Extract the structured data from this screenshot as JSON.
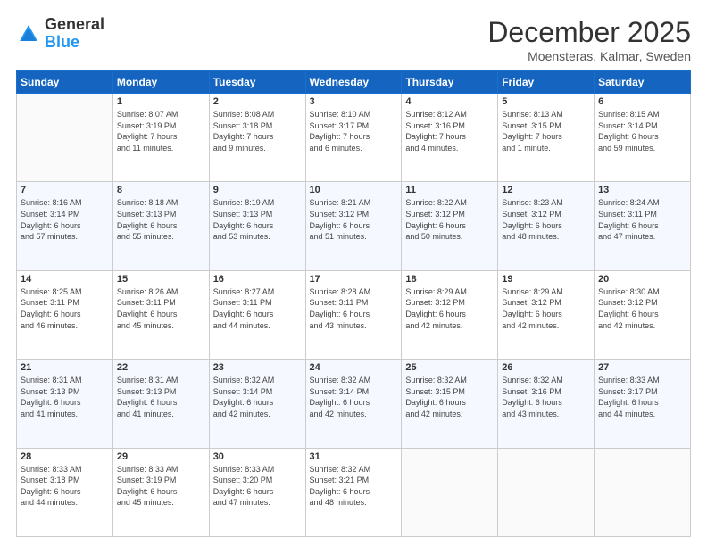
{
  "header": {
    "logo": {
      "line1": "General",
      "line2": "Blue"
    },
    "title": "December 2025",
    "subtitle": "Moensteras, Kalmar, Sweden"
  },
  "days_of_week": [
    "Sunday",
    "Monday",
    "Tuesday",
    "Wednesday",
    "Thursday",
    "Friday",
    "Saturday"
  ],
  "weeks": [
    [
      {
        "day": "",
        "info": ""
      },
      {
        "day": "1",
        "info": "Sunrise: 8:07 AM\nSunset: 3:19 PM\nDaylight: 7 hours\nand 11 minutes."
      },
      {
        "day": "2",
        "info": "Sunrise: 8:08 AM\nSunset: 3:18 PM\nDaylight: 7 hours\nand 9 minutes."
      },
      {
        "day": "3",
        "info": "Sunrise: 8:10 AM\nSunset: 3:17 PM\nDaylight: 7 hours\nand 6 minutes."
      },
      {
        "day": "4",
        "info": "Sunrise: 8:12 AM\nSunset: 3:16 PM\nDaylight: 7 hours\nand 4 minutes."
      },
      {
        "day": "5",
        "info": "Sunrise: 8:13 AM\nSunset: 3:15 PM\nDaylight: 7 hours\nand 1 minute."
      },
      {
        "day": "6",
        "info": "Sunrise: 8:15 AM\nSunset: 3:14 PM\nDaylight: 6 hours\nand 59 minutes."
      }
    ],
    [
      {
        "day": "7",
        "info": "Sunrise: 8:16 AM\nSunset: 3:14 PM\nDaylight: 6 hours\nand 57 minutes."
      },
      {
        "day": "8",
        "info": "Sunrise: 8:18 AM\nSunset: 3:13 PM\nDaylight: 6 hours\nand 55 minutes."
      },
      {
        "day": "9",
        "info": "Sunrise: 8:19 AM\nSunset: 3:13 PM\nDaylight: 6 hours\nand 53 minutes."
      },
      {
        "day": "10",
        "info": "Sunrise: 8:21 AM\nSunset: 3:12 PM\nDaylight: 6 hours\nand 51 minutes."
      },
      {
        "day": "11",
        "info": "Sunrise: 8:22 AM\nSunset: 3:12 PM\nDaylight: 6 hours\nand 50 minutes."
      },
      {
        "day": "12",
        "info": "Sunrise: 8:23 AM\nSunset: 3:12 PM\nDaylight: 6 hours\nand 48 minutes."
      },
      {
        "day": "13",
        "info": "Sunrise: 8:24 AM\nSunset: 3:11 PM\nDaylight: 6 hours\nand 47 minutes."
      }
    ],
    [
      {
        "day": "14",
        "info": "Sunrise: 8:25 AM\nSunset: 3:11 PM\nDaylight: 6 hours\nand 46 minutes."
      },
      {
        "day": "15",
        "info": "Sunrise: 8:26 AM\nSunset: 3:11 PM\nDaylight: 6 hours\nand 45 minutes."
      },
      {
        "day": "16",
        "info": "Sunrise: 8:27 AM\nSunset: 3:11 PM\nDaylight: 6 hours\nand 44 minutes."
      },
      {
        "day": "17",
        "info": "Sunrise: 8:28 AM\nSunset: 3:11 PM\nDaylight: 6 hours\nand 43 minutes."
      },
      {
        "day": "18",
        "info": "Sunrise: 8:29 AM\nSunset: 3:12 PM\nDaylight: 6 hours\nand 42 minutes."
      },
      {
        "day": "19",
        "info": "Sunrise: 8:29 AM\nSunset: 3:12 PM\nDaylight: 6 hours\nand 42 minutes."
      },
      {
        "day": "20",
        "info": "Sunrise: 8:30 AM\nSunset: 3:12 PM\nDaylight: 6 hours\nand 42 minutes."
      }
    ],
    [
      {
        "day": "21",
        "info": "Sunrise: 8:31 AM\nSunset: 3:13 PM\nDaylight: 6 hours\nand 41 minutes."
      },
      {
        "day": "22",
        "info": "Sunrise: 8:31 AM\nSunset: 3:13 PM\nDaylight: 6 hours\nand 41 minutes."
      },
      {
        "day": "23",
        "info": "Sunrise: 8:32 AM\nSunset: 3:14 PM\nDaylight: 6 hours\nand 42 minutes."
      },
      {
        "day": "24",
        "info": "Sunrise: 8:32 AM\nSunset: 3:14 PM\nDaylight: 6 hours\nand 42 minutes."
      },
      {
        "day": "25",
        "info": "Sunrise: 8:32 AM\nSunset: 3:15 PM\nDaylight: 6 hours\nand 42 minutes."
      },
      {
        "day": "26",
        "info": "Sunrise: 8:32 AM\nSunset: 3:16 PM\nDaylight: 6 hours\nand 43 minutes."
      },
      {
        "day": "27",
        "info": "Sunrise: 8:33 AM\nSunset: 3:17 PM\nDaylight: 6 hours\nand 44 minutes."
      }
    ],
    [
      {
        "day": "28",
        "info": "Sunrise: 8:33 AM\nSunset: 3:18 PM\nDaylight: 6 hours\nand 44 minutes."
      },
      {
        "day": "29",
        "info": "Sunrise: 8:33 AM\nSunset: 3:19 PM\nDaylight: 6 hours\nand 45 minutes."
      },
      {
        "day": "30",
        "info": "Sunrise: 8:33 AM\nSunset: 3:20 PM\nDaylight: 6 hours\nand 47 minutes."
      },
      {
        "day": "31",
        "info": "Sunrise: 8:32 AM\nSunset: 3:21 PM\nDaylight: 6 hours\nand 48 minutes."
      },
      {
        "day": "",
        "info": ""
      },
      {
        "day": "",
        "info": ""
      },
      {
        "day": "",
        "info": ""
      }
    ]
  ]
}
